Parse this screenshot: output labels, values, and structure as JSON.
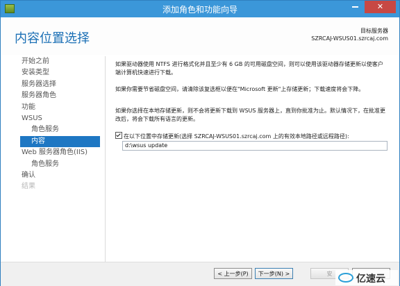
{
  "window": {
    "title": "添加角色和功能向导",
    "min_glyph": "—",
    "close_glyph": "✕"
  },
  "header": {
    "page_title": "内容位置选择",
    "target_label": "目标服务器",
    "target_value": "SZRCAJ-WSUS01.szrcaj.com"
  },
  "sidebar": {
    "items": [
      {
        "label": "开始之前"
      },
      {
        "label": "安装类型"
      },
      {
        "label": "服务器选择"
      },
      {
        "label": "服务器角色"
      },
      {
        "label": "功能"
      },
      {
        "label": "WSUS"
      },
      {
        "label": "角色服务"
      },
      {
        "label": "内容"
      },
      {
        "label": "Web 服务器角色(IIS)"
      },
      {
        "label": "角色服务"
      },
      {
        "label": "确认"
      },
      {
        "label": "结果"
      }
    ]
  },
  "content": {
    "para1": "如果驱动器使用 NTFS 进行格式化并且至少有 6 GB 的可用磁盘空间，则可以使用该驱动器存储更新以使客户端计算机快速进行下载。",
    "para2": "如果你需要节省磁盘空间，请清除该复选框以便在\"Microsoft 更新\"上存储更新；下载速度将会下降。",
    "para3": "如果你选择在本地存储更新，则不会将更新下载到 WSUS 服务器上，直到你批准为止。默认情况下，在批准更改后，将会下载所有语言的更新。",
    "checkbox_label": "在以下位置中存储更新(选择 SZRCAJ-WSUS01.szrcaj.com 上的有效本地路径或远程路径):",
    "checkbox_checked": true,
    "path_value": "d:\\wsus update"
  },
  "footer": {
    "prev_label": "< 上一步(P)",
    "next_label": "下一步(N) >",
    "install_label": "安",
    "cancel_label": ""
  },
  "watermark": {
    "text": "亿速云"
  },
  "colors": {
    "titlebar": "#3b97d9",
    "accent": "#1e77c3",
    "title_text": "#1a6fb5"
  }
}
